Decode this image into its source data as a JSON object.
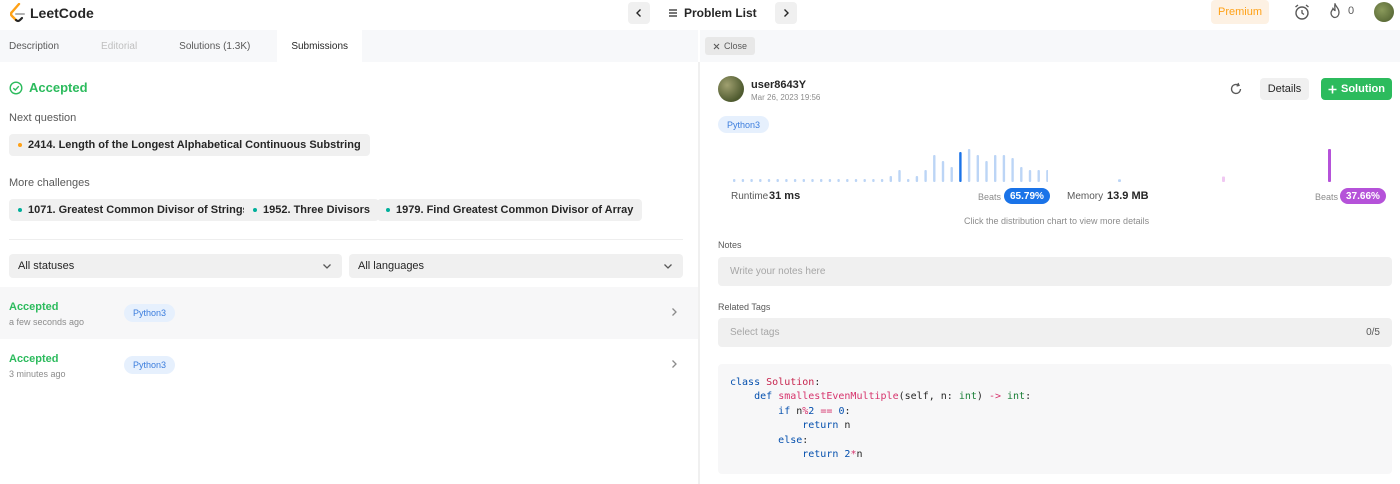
{
  "brand": {
    "name": "LeetCode"
  },
  "topbar": {
    "problem_list_label": "Problem List",
    "premium_label": "Premium",
    "streak_count": "0"
  },
  "left_tabs": [
    {
      "label": "Description",
      "state": "normal"
    },
    {
      "label": "Editorial",
      "state": "disabled"
    },
    {
      "label": "Solutions (1.3K)",
      "state": "normal"
    },
    {
      "label": "Submissions",
      "state": "active"
    }
  ],
  "result": {
    "status": "Accepted",
    "next_question_label": "Next question",
    "next_question": "2414. Length of the Longest Alphabetical Continuous Substring",
    "more_challenges_label": "More challenges",
    "challenges": [
      "1071. Greatest Common Divisor of Strings",
      "1952. Three Divisors",
      "1979. Find Greatest Common Divisor of Array"
    ]
  },
  "filters": {
    "status_select": "All statuses",
    "language_select": "All languages"
  },
  "submissions": [
    {
      "status": "Accepted",
      "time": "a few seconds ago",
      "language": "Python3"
    },
    {
      "status": "Accepted",
      "time": "3 minutes ago",
      "language": "Python3"
    }
  ],
  "right_header": {
    "close_label": "Close"
  },
  "detail": {
    "username": "user8643Y",
    "date": "Mar 26, 2023 19:56",
    "details_label": "Details",
    "solution_label": "Solution",
    "language": "Python3",
    "runtime_label": "Runtime",
    "runtime_value": "31 ms",
    "runtime_beats_label": "Beats",
    "runtime_beats": "65.79%",
    "memory_label": "Memory",
    "memory_value": "13.9 MB",
    "memory_beats_label": "Beats",
    "memory_beats": "37.66%",
    "hint": "Click the distribution chart to view more details",
    "notes_label": "Notes",
    "notes_placeholder": "Write your notes here",
    "tags_label": "Related Tags",
    "tags_placeholder": "Select tags",
    "tags_count": "0/5"
  },
  "code": [
    "class Solution:",
    "    def smallestEvenMultiple(self, n: int) -> int:",
    "        if n%2 == 0:",
    "            return n",
    "        else:",
    "            return 2*n"
  ],
  "colors": {
    "accent_green": "#2cbb5d",
    "runtime_beats": "#1a73e8",
    "memory_beats": "#b552d9",
    "premium": "#ffa116"
  },
  "chart_data": [
    {
      "type": "bar",
      "series": [
        {
          "values": [
            1,
            1,
            1,
            1,
            1,
            1,
            1,
            1,
            1,
            1,
            1,
            1,
            1,
            1,
            1,
            1,
            1,
            1,
            2,
            4,
            1,
            2,
            4,
            9,
            7,
            5,
            10,
            11,
            9,
            7,
            9,
            9,
            8,
            5,
            4,
            4,
            4
          ]
        }
      ],
      "highlight_index": 26,
      "colors": {
        "bar": "#bcd5f6",
        "highlight": "#1a73e8"
      }
    },
    {
      "type": "bar",
      "series": [
        {
          "values": [
            1,
            2,
            12
          ]
        }
      ],
      "colors": {
        "bar": "#bcd5f6",
        "mid": "#f0c8f2",
        "highlight": "#b552d9"
      }
    }
  ]
}
